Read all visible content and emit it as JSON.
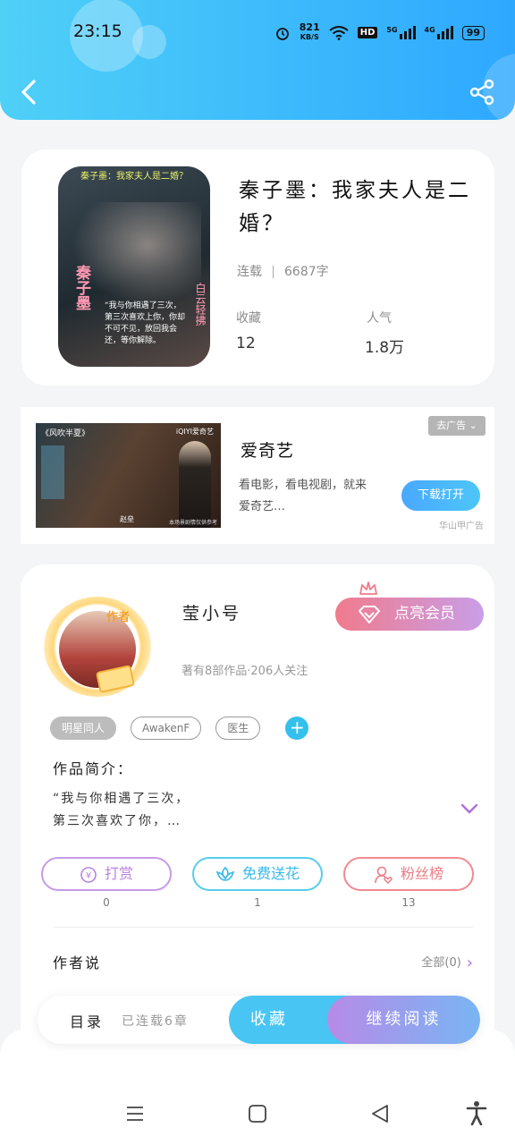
{
  "status_bar": {
    "time": "23:15",
    "net_speed": "821",
    "net_unit": "KB/S",
    "hd": "HD",
    "sig1": "5G",
    "sig2": "4G",
    "battery": "99"
  },
  "book": {
    "title": "秦子墨：我家夫人是二婚？",
    "status": "连载",
    "word_count": "6687字",
    "collect_label": "收藏",
    "collect_value": "12",
    "popularity_label": "人气",
    "popularity_value": "1.8万",
    "cover_caption": "秦子墨：我家夫人是二婚？",
    "cover_side_left": "秦子墨",
    "cover_side_right": "白云轻拂",
    "cover_quote": "“我与你相遇了三次，第三次喜欢上你，你却不可不见，放回我会还，等你解除。"
  },
  "ad": {
    "image_text_left": "《风吹半夏》",
    "image_text_right": "iQIYI爱奇艺",
    "image_text_bottom": "赵垒",
    "image_text_corner": "本场景剧情仅供参考",
    "name": "爱奇艺",
    "desc": "看电影，看电视剧，就来爱奇艺…",
    "close_label": "去广告",
    "download_label": "下载打开",
    "note": "华山甲广告"
  },
  "author": {
    "badge": "作者",
    "name": "莹小号",
    "info": "著有8部作品·206人关注",
    "vip_label": "点亮会员",
    "tags": [
      "明星同人",
      "AwakenF",
      "医生"
    ],
    "intro_label": "作品简介：",
    "intro_line1": "“我与你相遇了三次，",
    "intro_line2": "第三次喜欢了你，…",
    "actions": [
      {
        "label": "打赏",
        "count": "0"
      },
      {
        "label": "免费送花",
        "count": "1"
      },
      {
        "label": "粉丝榜",
        "count": "13"
      }
    ],
    "say_label": "作者说",
    "say_all": "全部(0)"
  },
  "bottom_bar": {
    "toc_label": "目录",
    "serial_label": "已连载6章",
    "collect_label": "收藏",
    "read_label": "继续阅读"
  },
  "colors": {
    "header_start": "#4fd0f7",
    "header_end": "#2ea8ff",
    "accent_blue": "#48c5f2",
    "accent_purple": "#b68be8",
    "vip_pink": "#f07b8c"
  }
}
